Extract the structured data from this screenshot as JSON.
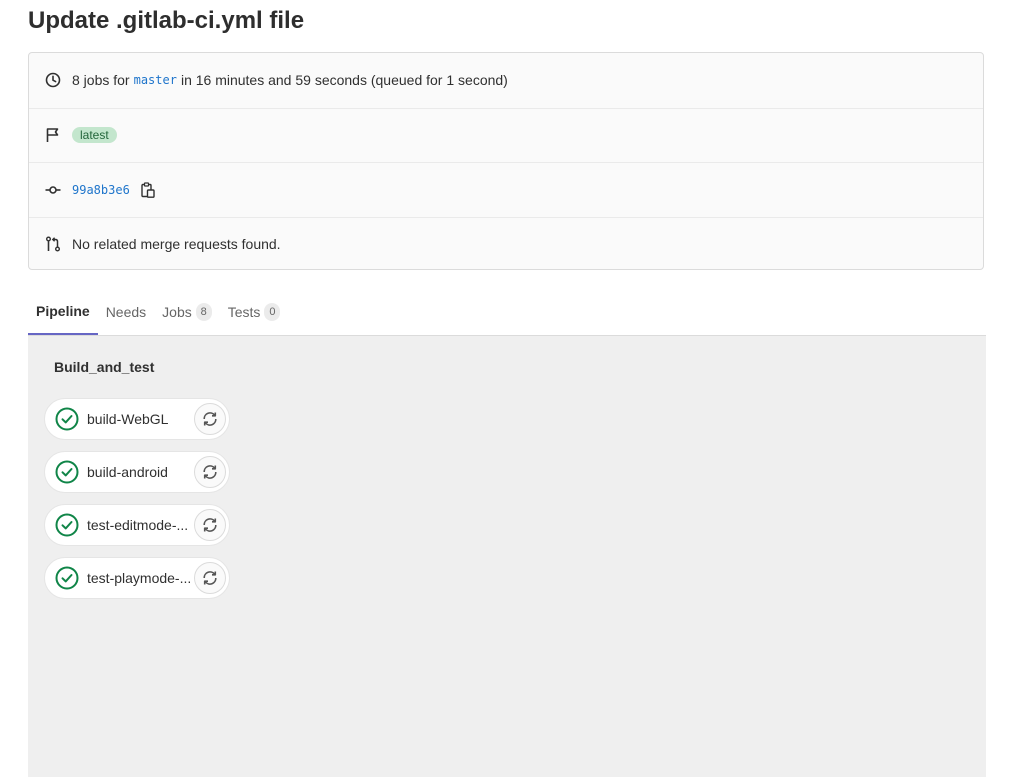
{
  "page": {
    "title": "Update .gitlab-ci.yml file"
  },
  "info": {
    "summary_prefix": "8 jobs for",
    "branch": "master",
    "summary_suffix": "in 16 minutes and 59 seconds (queued for 1 second)",
    "badge": "latest",
    "commit_sha": "99a8b3e6",
    "merge_requests": "No related merge requests found."
  },
  "tabs": [
    {
      "label": "Pipeline",
      "count": null,
      "active": true
    },
    {
      "label": "Needs",
      "count": null,
      "active": false
    },
    {
      "label": "Jobs",
      "count": "8",
      "active": false
    },
    {
      "label": "Tests",
      "count": "0",
      "active": false
    }
  ],
  "pipeline": {
    "stage": "Build_and_test",
    "jobs": [
      {
        "name": "build-WebGL",
        "status": "passed"
      },
      {
        "name": "build-android",
        "status": "passed"
      },
      {
        "name": "test-editmode-...",
        "status": "passed"
      },
      {
        "name": "test-playmode-...",
        "status": "passed"
      }
    ]
  },
  "colors": {
    "success": "#108548",
    "link": "#1f75cb",
    "active_tab": "#6666c4",
    "badge_bg": "#c3e6cd"
  },
  "icons": {
    "clock": "clock-icon",
    "flag": "flag-icon",
    "commit": "commit-icon",
    "copy": "copy-icon",
    "merge_request": "merge-request-icon",
    "status": "status-success-icon",
    "retry": "retry-icon"
  }
}
